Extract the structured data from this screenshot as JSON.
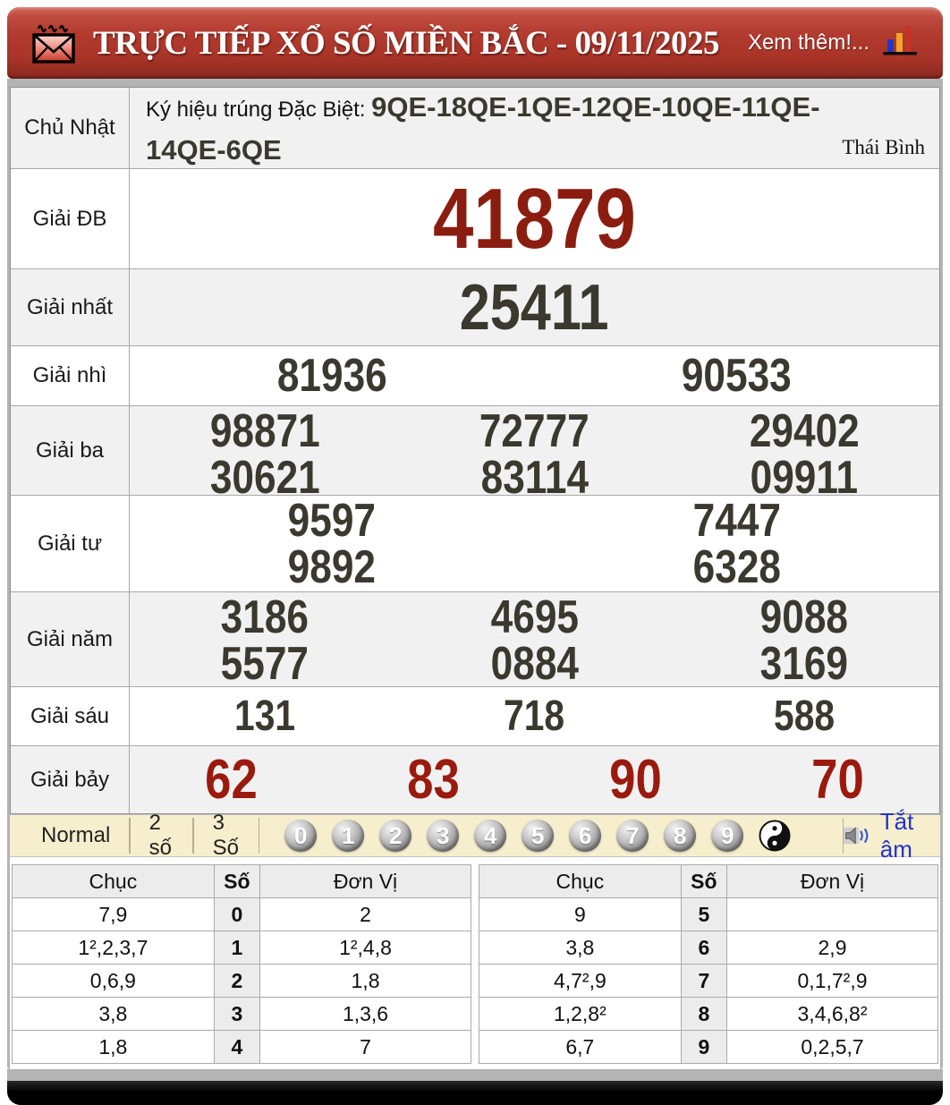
{
  "header": {
    "title": "TRỰC TIẾP XỔ SỐ MIỀN BẮC - 09/11/2025",
    "more_link": "Xem thêm!..."
  },
  "results": {
    "day_label": "Chủ Nhật",
    "symbol_label": "Ký hiệu trúng Đặc Biệt: ",
    "symbol_codes": "9QE-18QE-1QE-12QE-10QE-11QE-14QE-6QE",
    "province": "Thái Bình",
    "prizes": [
      {
        "label": "Giải ĐB",
        "rows": [
          [
            "41879"
          ]
        ]
      },
      {
        "label": "Giải nhất",
        "rows": [
          [
            "25411"
          ]
        ]
      },
      {
        "label": "Giải nhì",
        "rows": [
          [
            "81936",
            "90533"
          ]
        ]
      },
      {
        "label": "Giải ba",
        "rows": [
          [
            "98871",
            "72777",
            "29402"
          ],
          [
            "30621",
            "83114",
            "09911"
          ]
        ]
      },
      {
        "label": "Giải tư",
        "rows": [
          [
            "9597",
            "7447"
          ],
          [
            "9892",
            "6328"
          ]
        ]
      },
      {
        "label": "Giải năm",
        "rows": [
          [
            "3186",
            "4695",
            "9088"
          ],
          [
            "5577",
            "0884",
            "3169"
          ]
        ]
      },
      {
        "label": "Giải sáu",
        "rows": [
          [
            "131",
            "718",
            "588"
          ]
        ]
      },
      {
        "label": "Giải bảy",
        "rows": [
          [
            "62",
            "83",
            "90",
            "70"
          ]
        ]
      }
    ]
  },
  "controls": {
    "modes": [
      "Normal",
      "2 số",
      "3 Số"
    ],
    "digits": [
      "0",
      "1",
      "2",
      "3",
      "4",
      "5",
      "6",
      "7",
      "8",
      "9"
    ],
    "mute_label": "Tắt âm"
  },
  "stats": {
    "headers": [
      "Chục",
      "Số",
      "Đơn Vị"
    ],
    "left": [
      [
        "7,9",
        "0",
        "2"
      ],
      [
        "1²,2,3,7",
        "1",
        "1²,4,8"
      ],
      [
        "0,6,9",
        "2",
        "1,8"
      ],
      [
        "3,8",
        "3",
        "1,3,6"
      ],
      [
        "1,8",
        "4",
        "7"
      ]
    ],
    "right": [
      [
        "9",
        "5",
        ""
      ],
      [
        "3,8",
        "6",
        "2,9"
      ],
      [
        "4,7²,9",
        "7",
        "0,1,7²,9"
      ],
      [
        "1,2,8²",
        "8",
        "3,4,6,8²"
      ],
      [
        "6,7",
        "9",
        "0,2,5,7"
      ]
    ]
  },
  "colors": {
    "header_red": "#b23a2e",
    "special_red": "#8b1d10",
    "seventh_red": "#9a1b0e",
    "control_cream": "#f7eecd",
    "mute_blue": "#2233cc"
  }
}
